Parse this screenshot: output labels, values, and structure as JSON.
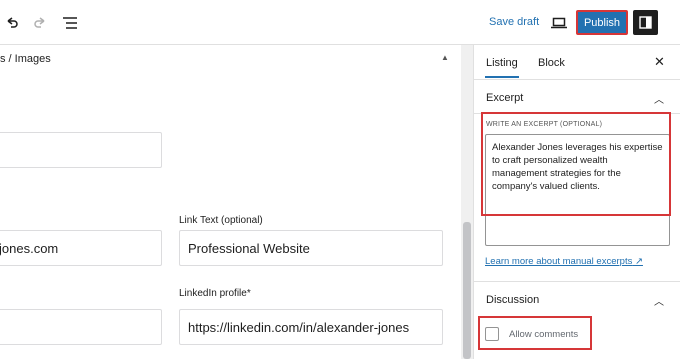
{
  "toolbar": {
    "save_draft": "Save draft",
    "publish": "Publish",
    "icons": [
      "undo-icon",
      "redo-icon",
      "list-view-icon",
      "preview-icon",
      "settings-icon"
    ]
  },
  "editor": {
    "section_title": "s / Images",
    "fields": [
      {
        "label": "",
        "value": ""
      },
      {
        "label": "",
        "value": "jones.com"
      },
      {
        "label": "Link Text (optional)",
        "value": "Professional Website"
      },
      {
        "label": "",
        "value": ""
      },
      {
        "label": "LinkedIn profile*",
        "value": "https://linkedin.com/in/alexander-jones"
      }
    ]
  },
  "sidebar": {
    "tabs": [
      "Listing",
      "Block"
    ],
    "active_tab": "Listing",
    "excerpt": {
      "title": "Excerpt",
      "label": "WRITE AN EXCERPT (OPTIONAL)",
      "text": "Alexander Jones leverages his expertise to craft personalized wealth management strategies for the company's valued clients.",
      "link": "Learn more about manual excerpts"
    },
    "discussion": {
      "title": "Discussion",
      "allow_comments": "Allow comments",
      "checked": false
    }
  },
  "colors": {
    "accent": "#2271b1",
    "highlight": "#d63638"
  }
}
